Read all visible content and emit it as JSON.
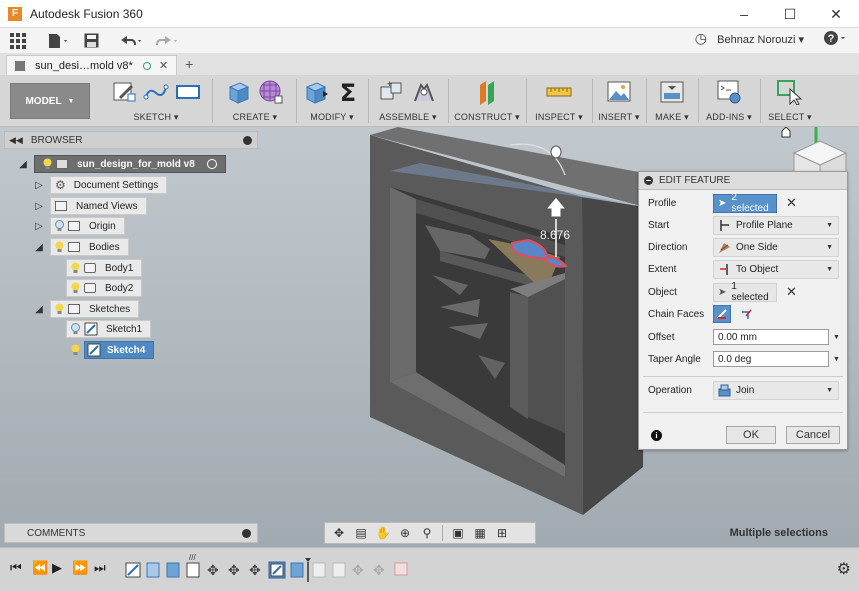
{
  "window": {
    "title": "Autodesk Fusion 360",
    "controls": [
      "minimize-icon",
      "maximize-icon",
      "close-icon"
    ]
  },
  "app_toolbar": {
    "user": "Behnaz Norouzi ▾",
    "help": "?"
  },
  "document_tab": {
    "name": "sun_desi…mold v8*",
    "add": "+"
  },
  "ribbon": {
    "workspace": "MODEL",
    "groups": [
      {
        "label": "SKETCH ▾"
      },
      {
        "label": "CREATE ▾"
      },
      {
        "label": "MODIFY ▾"
      },
      {
        "label": "ASSEMBLE ▾"
      },
      {
        "label": "CONSTRUCT ▾"
      },
      {
        "label": "INSPECT ▾"
      },
      {
        "label": "INSERT ▾"
      },
      {
        "label": "MAKE ▾"
      },
      {
        "label": "ADD-INS ▾"
      },
      {
        "label": "SELECT ▾"
      }
    ]
  },
  "browser": {
    "header": "BROWSER",
    "root": "sun_design_for_mold v8",
    "items": {
      "document_settings": "Document Settings",
      "named_views": "Named Views",
      "origin": "Origin",
      "bodies": "Bodies",
      "body1": "Body1",
      "body2": "Body2",
      "sketches": "Sketches",
      "sketch1": "Sketch1",
      "sketch4": "Sketch4"
    }
  },
  "viewport": {
    "dimension_value": "8.676"
  },
  "edit_feature": {
    "title": "EDIT FEATURE",
    "rows": {
      "profile": {
        "label": "Profile",
        "value": "2 selected"
      },
      "start": {
        "label": "Start",
        "value": "Profile Plane"
      },
      "direction": {
        "label": "Direction",
        "value": "One Side"
      },
      "extent": {
        "label": "Extent",
        "value": "To Object"
      },
      "object": {
        "label": "Object",
        "value": "1 selected"
      },
      "chain_faces": {
        "label": "Chain Faces"
      },
      "offset": {
        "label": "Offset",
        "value": "0.00 mm"
      },
      "taper_angle": {
        "label": "Taper Angle",
        "value": "0.0 deg"
      },
      "operation": {
        "label": "Operation",
        "value": "Join"
      }
    },
    "ok": "OK",
    "cancel": "Cancel"
  },
  "comments": {
    "header": "COMMENTS"
  },
  "status": {
    "message": "Multiple selections"
  },
  "colors": {
    "ribbon_bg": "#d6d6d6",
    "selection_blue": "#5991cb",
    "viewport_top": "#c1c8ce",
    "viewport_bottom": "#a2aab1",
    "model_body": "#585858"
  }
}
